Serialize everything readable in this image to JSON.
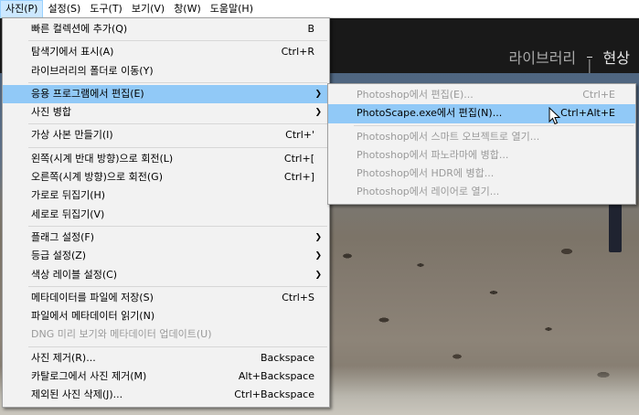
{
  "menubar": {
    "items": [
      {
        "label": "사진(P)",
        "active": true
      },
      {
        "label": "설정(S)"
      },
      {
        "label": "도구(T)"
      },
      {
        "label": "보기(V)"
      },
      {
        "label": "창(W)"
      },
      {
        "label": "도움말(H)"
      }
    ]
  },
  "header": {
    "modules": [
      "라이브러리",
      "현상"
    ],
    "current_module": "현상"
  },
  "menu": {
    "items": [
      {
        "label": "빠른 컬렉션에 추가(Q)",
        "shortcut": "B"
      },
      {
        "label": "탐색기에서 표시(A)",
        "shortcut": "Ctrl+R"
      },
      {
        "label": "라이브러리의 폴더로 이동(Y)",
        "shortcut": ""
      },
      {
        "label": "응용 프로그램에서 편집(E)",
        "shortcut": ""
      },
      {
        "label": "사진 병합",
        "shortcut": ""
      },
      {
        "label": "가상 사본 만들기(I)",
        "shortcut": "Ctrl+'"
      },
      {
        "label": "왼쪽(시계 반대 방향)으로 회전(L)",
        "shortcut": "Ctrl+["
      },
      {
        "label": "오른쪽(시계 방향)으로 회전(G)",
        "shortcut": "Ctrl+]"
      },
      {
        "label": "가로로 뒤집기(H)",
        "shortcut": ""
      },
      {
        "label": "세로로 뒤집기(V)",
        "shortcut": ""
      },
      {
        "label": "플래그 설정(F)",
        "shortcut": ""
      },
      {
        "label": "등급 설정(Z)",
        "shortcut": ""
      },
      {
        "label": "색상 레이블 설정(C)",
        "shortcut": ""
      },
      {
        "label": "메타데이터를 파일에 저장(S)",
        "shortcut": "Ctrl+S"
      },
      {
        "label": "파일에서 메타데이터 읽기(N)",
        "shortcut": ""
      },
      {
        "label": "DNG 미리 보기와 메타데이터 업데이트(U)",
        "shortcut": ""
      },
      {
        "label": "사진 제거(R)...",
        "shortcut": "Backspace"
      },
      {
        "label": "카탈로그에서 사진 제거(M)",
        "shortcut": "Alt+Backspace"
      },
      {
        "label": "제외된 사진 삭제(J)...",
        "shortcut": "Ctrl+Backspace"
      }
    ]
  },
  "submenu": {
    "items": [
      {
        "label": "Photoshop에서 편집(E)...",
        "shortcut": "Ctrl+E"
      },
      {
        "label": "PhotoScape.exe에서 편집(N)...",
        "shortcut": "Ctrl+Alt+E"
      },
      {
        "label": "Photoshop에서 스마트 오브젝트로 열기...",
        "shortcut": ""
      },
      {
        "label": "Photoshop에서 파노라마에 병합...",
        "shortcut": ""
      },
      {
        "label": "Photoshop에서 HDR에 병합...",
        "shortcut": ""
      },
      {
        "label": "Photoshop에서 레이어로 열기...",
        "shortcut": ""
      }
    ]
  },
  "icons": {
    "submenu_arrow": "chevron-right-icon",
    "cursor": "mouse-pointer-icon"
  },
  "colors": {
    "highlight": "#91c9f7",
    "menu_bg": "#f2f2f2",
    "disabled_text": "#9a9a9a",
    "header_bg": "#191919"
  }
}
